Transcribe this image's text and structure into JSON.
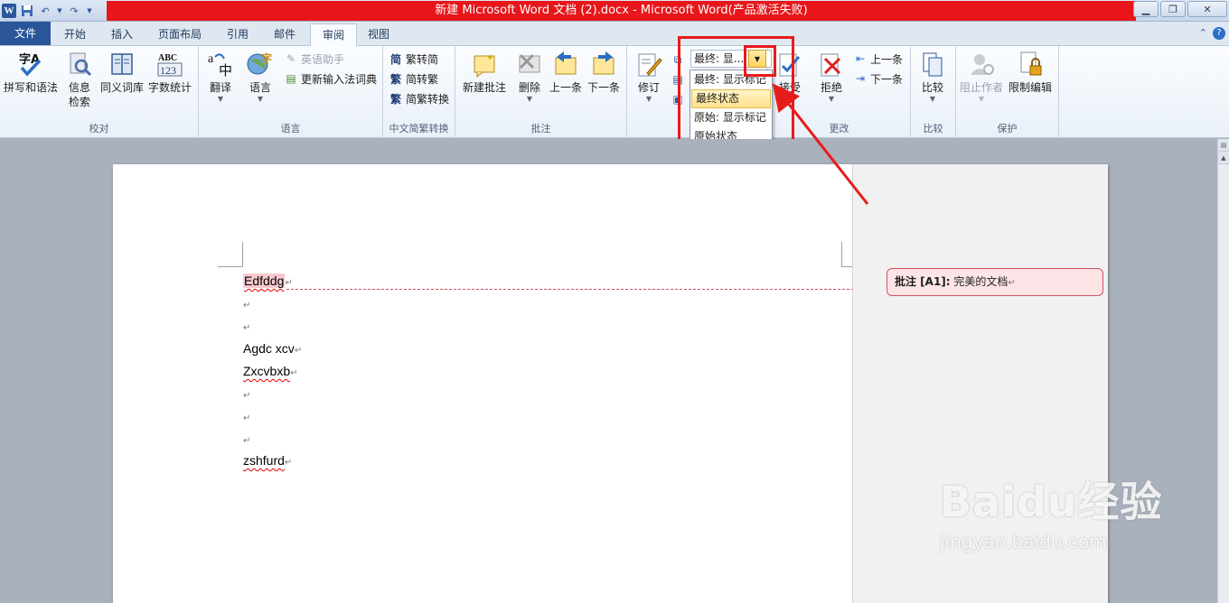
{
  "titlebar": {
    "title": "新建 Microsoft Word 文档 (2).docx  -  Microsoft Word(产品激活失败)",
    "app_icon_letter": "W"
  },
  "tabs": [
    {
      "label": "文件"
    },
    {
      "label": "开始"
    },
    {
      "label": "插入"
    },
    {
      "label": "页面布局"
    },
    {
      "label": "引用"
    },
    {
      "label": "邮件"
    },
    {
      "label": "审阅"
    },
    {
      "label": "视图"
    }
  ],
  "active_tab": "审阅",
  "ribbon": {
    "proofing": {
      "label": "校对",
      "spelling": "拼写和语法",
      "research_1": "信息",
      "research_2": "检索",
      "thesaurus": "同义词库",
      "wordcount": "字数统计"
    },
    "language": {
      "label": "语言",
      "translate": "翻译",
      "language": "语言",
      "english_assistant": "英语助手",
      "update_ime": "更新输入法词典"
    },
    "chinese_conversion": {
      "label": "中文简繁转换",
      "to_simplified": "繁转简",
      "to_traditional": "简转繁",
      "convert": "简繁转换"
    },
    "comments": {
      "label": "批注",
      "new": "新建批注",
      "delete": "删除",
      "previous": "上一条",
      "next": "下一条"
    },
    "tracking": {
      "track_changes": "修订",
      "display_value": "最终: 显...",
      "options": [
        "最终: 显示标记",
        "最终状态",
        "原始: 显示标记",
        "原始状态"
      ],
      "highlighted_option": "最终状态"
    },
    "changes": {
      "label": "更改",
      "accept": "接受",
      "reject": "拒绝",
      "previous": "上一条",
      "next": "下一条"
    },
    "compare": {
      "label": "比较",
      "compare": "比较"
    },
    "protect": {
      "label": "保护",
      "block_authors": "阻止作者",
      "restrict_editing": "限制编辑"
    }
  },
  "document": {
    "lines": [
      "Edfddg",
      "",
      "",
      "Agdc xcv",
      "Zxcvbxb",
      "",
      "",
      "",
      "zshfurd"
    ],
    "paragraph_mark": "↵",
    "comment": {
      "label": "批注 [A1]:",
      "text": "完美的文档"
    }
  },
  "watermark": {
    "brand": "Baidu经验",
    "url": "jingyan.baidu.com"
  },
  "colors": {
    "title_bar_red": "#e8161a",
    "file_tab": "#2a5699",
    "annotation_red": "#e81b1b",
    "comment_fill": "#fde5e7"
  }
}
